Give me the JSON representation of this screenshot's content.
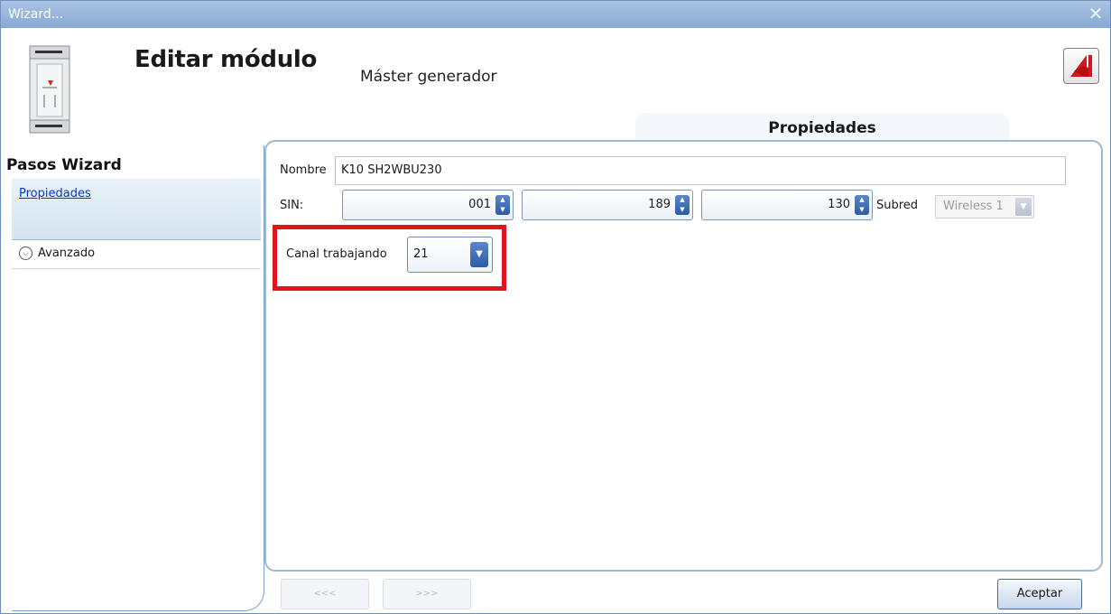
{
  "window": {
    "title": "Wizard...",
    "close_glyph": "✕"
  },
  "header": {
    "title": "Editar módulo",
    "subtitle": "Máster generador"
  },
  "tab": {
    "label": "Propiedades"
  },
  "sidebar": {
    "title": "Pasos Wizard",
    "items": [
      {
        "label": "Propiedades"
      }
    ],
    "advanced": {
      "label": "Avanzado",
      "icon": "chevron-down-circle-icon"
    }
  },
  "form": {
    "nombre": {
      "label": "Nombre",
      "value": "K10 SH2WBU230"
    },
    "sin": {
      "label": "SIN:",
      "values": [
        "001",
        "189",
        "130"
      ]
    },
    "subred": {
      "label": "Subred",
      "value": "Wireless 1"
    },
    "canal": {
      "label": "Canal trabajando",
      "value": "21"
    }
  },
  "footer": {
    "prev": "<<<",
    "next": ">>>",
    "ok": "Aceptar"
  },
  "colors": {
    "highlight": "#e0141e",
    "accent": "#2b5ba8",
    "titlebar": "#9ab7dc"
  }
}
